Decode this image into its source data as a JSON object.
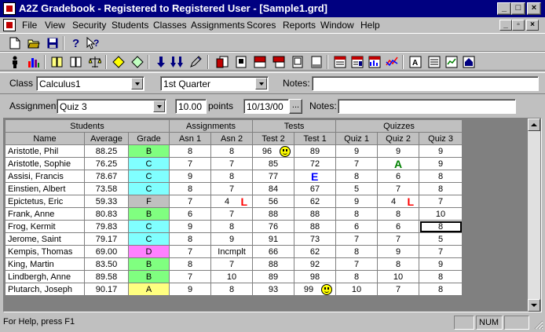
{
  "window": {
    "title": "A2Z Gradebook - Registered to Registered User - [Sample1.grd]",
    "controls": [
      "_",
      "□",
      "×"
    ],
    "doc_controls": [
      "_",
      "▫",
      "×"
    ]
  },
  "menu": [
    "File",
    "View",
    "Security",
    "Students",
    "Classes",
    "Assignments",
    "Scores",
    "Reports",
    "Window",
    "Help"
  ],
  "toolbar1": [
    "new-file",
    "open-folder",
    "save",
    "help",
    "context-help"
  ],
  "toolbar2": [
    "student",
    "chart",
    "book-open",
    "book",
    "scale",
    "tag",
    "tag-alt",
    "arrow-down",
    "arrow-down-double",
    "pencil",
    "report-1",
    "report-2",
    "report-3",
    "report-4",
    "report-5",
    "report-6",
    "report-7",
    "report-8",
    "report-9",
    "report-10",
    "report-11",
    "report-12",
    "report-13"
  ],
  "class_row": {
    "class_label": "Class",
    "class_value": "Calculus1",
    "term_value": "1st Quarter",
    "notes_label": "Notes:",
    "notes_value": ""
  },
  "assignment_row": {
    "label": "Assignment",
    "value": "Quiz 3",
    "points_value": "10.00",
    "points_label": "points",
    "date_value": "10/13/00",
    "date_button": "...",
    "notes_label": "Notes:",
    "notes_value": ""
  },
  "grid": {
    "groups": [
      {
        "label": "Students",
        "span": 3
      },
      {
        "label": "Assignments",
        "span": 2
      },
      {
        "label": "Tests",
        "span": 2
      },
      {
        "label": "Quizzes",
        "span": 3
      }
    ],
    "columns": [
      "Name",
      "Average",
      "Grade",
      "Asn 1",
      "Asn 2",
      "Test 2",
      "Test 1",
      "Quiz 1",
      "Quiz 2",
      "Quiz 3"
    ],
    "rows": [
      {
        "cells": [
          "Aristotle, Phil",
          "88.25",
          "B",
          "8",
          "8",
          "96",
          "89",
          "9",
          "9",
          "9"
        ],
        "marks": {
          "5": "smiley"
        }
      },
      {
        "cells": [
          "Aristotle, Sophie",
          "76.25",
          "C",
          "7",
          "7",
          "85",
          "72",
          "7",
          "",
          "9"
        ],
        "marks": {
          "8": "A"
        }
      },
      {
        "cells": [
          "Assisi, Francis",
          "78.67",
          "C",
          "9",
          "8",
          "77",
          "",
          "8",
          "6",
          "8"
        ],
        "marks": {
          "6": "E"
        }
      },
      {
        "cells": [
          "Einstien, Albert",
          "73.58",
          "C",
          "8",
          "7",
          "84",
          "67",
          "5",
          "7",
          "8"
        ],
        "marks": {}
      },
      {
        "cells": [
          "Epictetus, Eric",
          "59.33",
          "F",
          "7",
          "4",
          "56",
          "62",
          "9",
          "4",
          "7"
        ],
        "marks": {
          "4": "L",
          "8": "L"
        }
      },
      {
        "cells": [
          "Frank, Anne",
          "80.83",
          "B",
          "6",
          "7",
          "88",
          "88",
          "8",
          "8",
          "10"
        ],
        "marks": {}
      },
      {
        "cells": [
          "Frog, Kermit",
          "79.83",
          "C",
          "9",
          "8",
          "76",
          "88",
          "6",
          "6",
          "8"
        ],
        "marks": {}
      },
      {
        "cells": [
          "Jerome, Saint",
          "79.17",
          "C",
          "8",
          "9",
          "91",
          "73",
          "7",
          "7",
          "5"
        ],
        "marks": {}
      },
      {
        "cells": [
          "Kempis, Thomas",
          "69.00",
          "D",
          "7",
          "Incmplt",
          "66",
          "62",
          "8",
          "9",
          "7"
        ],
        "marks": {}
      },
      {
        "cells": [
          "King, Martin",
          "83.50",
          "B",
          "8",
          "7",
          "88",
          "92",
          "7",
          "8",
          "9"
        ],
        "marks": {}
      },
      {
        "cells": [
          "Lindbergh, Anne",
          "89.58",
          "B",
          "7",
          "10",
          "89",
          "98",
          "8",
          "10",
          "8"
        ],
        "marks": {}
      },
      {
        "cells": [
          "Plutarch, Joseph",
          "90.17",
          "A",
          "9",
          "8",
          "93",
          "99",
          "10",
          "7",
          "8"
        ],
        "marks": {
          "6": "smiley"
        }
      }
    ],
    "selected_cell": {
      "row": 6,
      "col": 9
    },
    "grade_colors": {
      "A": "#ffff80",
      "B": "#80ff80",
      "C": "#80ffff",
      "D": "#ff80ff",
      "F": "#c0c0c0"
    },
    "mark_colors": {
      "A": "#008000",
      "E": "#0000ff",
      "L": "#ff0000"
    }
  },
  "status": {
    "text": "For Help, press F1",
    "num": "NUM"
  },
  "colors": {
    "titlebar": "#000080",
    "face": "#c0c0c0"
  }
}
